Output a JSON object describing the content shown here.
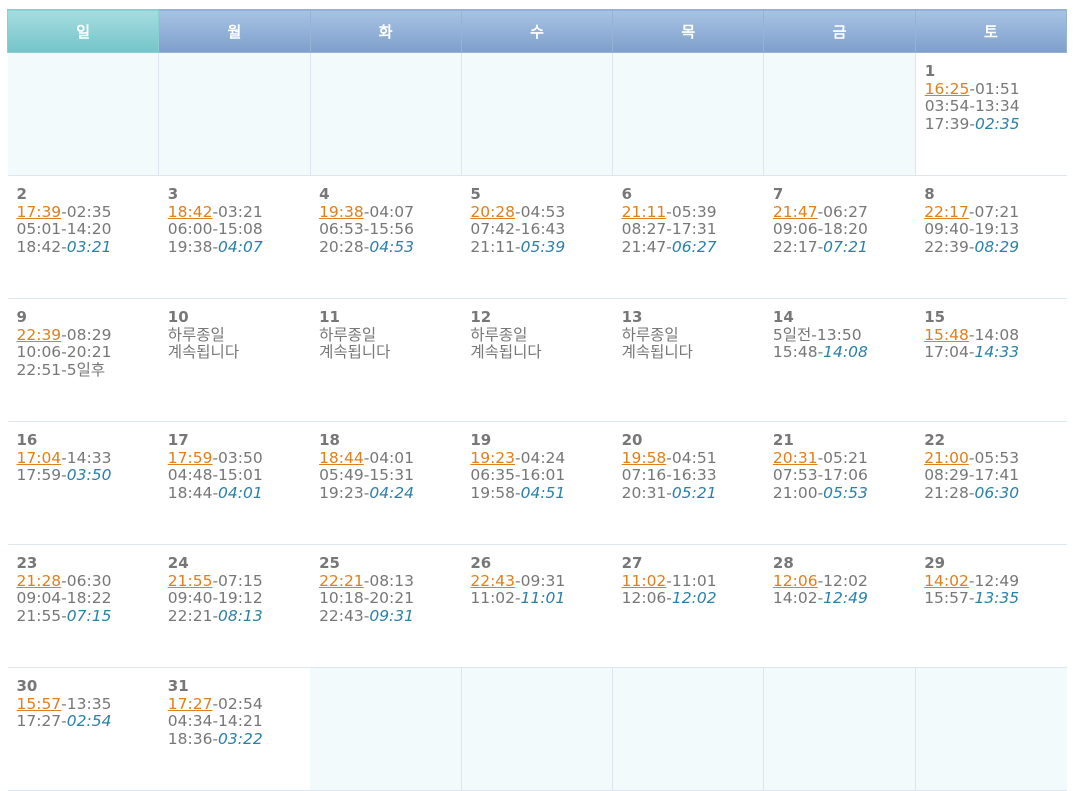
{
  "weekdays": [
    "일",
    "월",
    "화",
    "수",
    "목",
    "금",
    "토"
  ],
  "weeks": [
    [
      null,
      null,
      null,
      null,
      null,
      null,
      {
        "day": "1",
        "lines": [
          [
            {
              "t": "16:25",
              "c": "orange"
            },
            {
              "t": "-01:51"
            }
          ],
          [
            {
              "t": "03:54-13:34"
            }
          ],
          [
            {
              "t": "17:39-"
            },
            {
              "t": "02:35",
              "c": "blue"
            }
          ]
        ]
      }
    ],
    [
      {
        "day": "2",
        "lines": [
          [
            {
              "t": "17:39",
              "c": "orange"
            },
            {
              "t": "-02:35"
            }
          ],
          [
            {
              "t": "05:01-14:20"
            }
          ],
          [
            {
              "t": "18:42-"
            },
            {
              "t": "03:21",
              "c": "blue"
            }
          ]
        ]
      },
      {
        "day": "3",
        "lines": [
          [
            {
              "t": "18:42",
              "c": "orange"
            },
            {
              "t": "-03:21"
            }
          ],
          [
            {
              "t": "06:00-15:08"
            }
          ],
          [
            {
              "t": "19:38-"
            },
            {
              "t": "04:07",
              "c": "blue"
            }
          ]
        ]
      },
      {
        "day": "4",
        "lines": [
          [
            {
              "t": "19:38",
              "c": "orange"
            },
            {
              "t": "-04:07"
            }
          ],
          [
            {
              "t": "06:53-15:56"
            }
          ],
          [
            {
              "t": "20:28-"
            },
            {
              "t": "04:53",
              "c": "blue"
            }
          ]
        ]
      },
      {
        "day": "5",
        "lines": [
          [
            {
              "t": "20:28",
              "c": "orange"
            },
            {
              "t": "-04:53"
            }
          ],
          [
            {
              "t": "07:42-16:43"
            }
          ],
          [
            {
              "t": "21:11-"
            },
            {
              "t": "05:39",
              "c": "blue"
            }
          ]
        ]
      },
      {
        "day": "6",
        "lines": [
          [
            {
              "t": "21:11",
              "c": "orange"
            },
            {
              "t": "-05:39"
            }
          ],
          [
            {
              "t": "08:27-17:31"
            }
          ],
          [
            {
              "t": "21:47-"
            },
            {
              "t": "06:27",
              "c": "blue"
            }
          ]
        ]
      },
      {
        "day": "7",
        "lines": [
          [
            {
              "t": "21:47",
              "c": "orange"
            },
            {
              "t": "-06:27"
            }
          ],
          [
            {
              "t": "09:06-18:20"
            }
          ],
          [
            {
              "t": "22:17-"
            },
            {
              "t": "07:21",
              "c": "blue"
            }
          ]
        ]
      },
      {
        "day": "8",
        "lines": [
          [
            {
              "t": "22:17",
              "c": "orange"
            },
            {
              "t": "-07:21"
            }
          ],
          [
            {
              "t": "09:40-19:13"
            }
          ],
          [
            {
              "t": "22:39-"
            },
            {
              "t": "08:29",
              "c": "blue"
            }
          ]
        ]
      }
    ],
    [
      {
        "day": "9",
        "lines": [
          [
            {
              "t": "22:39",
              "c": "orange"
            },
            {
              "t": "-08:29"
            }
          ],
          [
            {
              "t": "10:06-20:21"
            }
          ],
          [
            {
              "t": "22:51-5일후"
            }
          ]
        ]
      },
      {
        "day": "10",
        "wrap": "하루종일 계속됩니다"
      },
      {
        "day": "11",
        "wrap": "하루종일 계속됩니다"
      },
      {
        "day": "12",
        "wrap": "하루종일 계속됩니다"
      },
      {
        "day": "13",
        "wrap": "하루종일 계속됩니다"
      },
      {
        "day": "14",
        "lines": [
          [
            {
              "t": "5일전-13:50"
            }
          ],
          [
            {
              "t": "15:48-"
            },
            {
              "t": "14:08",
              "c": "blue"
            }
          ]
        ]
      },
      {
        "day": "15",
        "lines": [
          [
            {
              "t": "15:48",
              "c": "orange"
            },
            {
              "t": "-14:08"
            }
          ],
          [
            {
              "t": "17:04-"
            },
            {
              "t": "14:33",
              "c": "blue"
            }
          ]
        ]
      }
    ],
    [
      {
        "day": "16",
        "lines": [
          [
            {
              "t": "17:04",
              "c": "orange"
            },
            {
              "t": "-14:33"
            }
          ],
          [
            {
              "t": "17:59-"
            },
            {
              "t": "03:50",
              "c": "blue"
            }
          ]
        ]
      },
      {
        "day": "17",
        "lines": [
          [
            {
              "t": "17:59",
              "c": "orange"
            },
            {
              "t": "-03:50"
            }
          ],
          [
            {
              "t": "04:48-15:01"
            }
          ],
          [
            {
              "t": "18:44-"
            },
            {
              "t": "04:01",
              "c": "blue"
            }
          ]
        ]
      },
      {
        "day": "18",
        "lines": [
          [
            {
              "t": "18:44",
              "c": "orange"
            },
            {
              "t": "-04:01"
            }
          ],
          [
            {
              "t": "05:49-15:31"
            }
          ],
          [
            {
              "t": "19:23-"
            },
            {
              "t": "04:24",
              "c": "blue"
            }
          ]
        ]
      },
      {
        "day": "19",
        "lines": [
          [
            {
              "t": "19:23",
              "c": "orange"
            },
            {
              "t": "-04:24"
            }
          ],
          [
            {
              "t": "06:35-16:01"
            }
          ],
          [
            {
              "t": "19:58-"
            },
            {
              "t": "04:51",
              "c": "blue"
            }
          ]
        ]
      },
      {
        "day": "20",
        "lines": [
          [
            {
              "t": "19:58",
              "c": "orange"
            },
            {
              "t": "-04:51"
            }
          ],
          [
            {
              "t": "07:16-16:33"
            }
          ],
          [
            {
              "t": "20:31-"
            },
            {
              "t": "05:21",
              "c": "blue"
            }
          ]
        ]
      },
      {
        "day": "21",
        "lines": [
          [
            {
              "t": "20:31",
              "c": "orange"
            },
            {
              "t": "-05:21"
            }
          ],
          [
            {
              "t": "07:53-17:06"
            }
          ],
          [
            {
              "t": "21:00-"
            },
            {
              "t": "05:53",
              "c": "blue"
            }
          ]
        ]
      },
      {
        "day": "22",
        "lines": [
          [
            {
              "t": "21:00",
              "c": "orange"
            },
            {
              "t": "-05:53"
            }
          ],
          [
            {
              "t": "08:29-17:41"
            }
          ],
          [
            {
              "t": "21:28-"
            },
            {
              "t": "06:30",
              "c": "blue"
            }
          ]
        ]
      }
    ],
    [
      {
        "day": "23",
        "lines": [
          [
            {
              "t": "21:28",
              "c": "orange"
            },
            {
              "t": "-06:30"
            }
          ],
          [
            {
              "t": "09:04-18:22"
            }
          ],
          [
            {
              "t": "21:55-"
            },
            {
              "t": "07:15",
              "c": "blue"
            }
          ]
        ]
      },
      {
        "day": "24",
        "lines": [
          [
            {
              "t": "21:55",
              "c": "orange"
            },
            {
              "t": "-07:15"
            }
          ],
          [
            {
              "t": "09:40-19:12"
            }
          ],
          [
            {
              "t": "22:21-"
            },
            {
              "t": "08:13",
              "c": "blue"
            }
          ]
        ]
      },
      {
        "day": "25",
        "lines": [
          [
            {
              "t": "22:21",
              "c": "orange"
            },
            {
              "t": "-08:13"
            }
          ],
          [
            {
              "t": "10:18-20:21"
            }
          ],
          [
            {
              "t": "22:43-"
            },
            {
              "t": "09:31",
              "c": "blue"
            }
          ]
        ]
      },
      {
        "day": "26",
        "lines": [
          [
            {
              "t": "22:43",
              "c": "orange"
            },
            {
              "t": "-09:31"
            }
          ],
          [
            {
              "t": "11:02-"
            },
            {
              "t": "11:01",
              "c": "blue"
            }
          ]
        ]
      },
      {
        "day": "27",
        "lines": [
          [
            {
              "t": "11:02",
              "c": "orange"
            },
            {
              "t": "-11:01"
            }
          ],
          [
            {
              "t": "12:06-"
            },
            {
              "t": "12:02",
              "c": "blue"
            }
          ]
        ]
      },
      {
        "day": "28",
        "lines": [
          [
            {
              "t": "12:06",
              "c": "orange"
            },
            {
              "t": "-12:02"
            }
          ],
          [
            {
              "t": "14:02-"
            },
            {
              "t": "12:49",
              "c": "blue"
            }
          ]
        ]
      },
      {
        "day": "29",
        "lines": [
          [
            {
              "t": "14:02",
              "c": "orange"
            },
            {
              "t": "-12:49"
            }
          ],
          [
            {
              "t": "15:57-"
            },
            {
              "t": "13:35",
              "c": "blue"
            }
          ]
        ]
      }
    ],
    [
      {
        "day": "30",
        "lines": [
          [
            {
              "t": "15:57",
              "c": "orange"
            },
            {
              "t": "-13:35"
            }
          ],
          [
            {
              "t": "17:27-"
            },
            {
              "t": "02:54",
              "c": "blue"
            }
          ]
        ]
      },
      {
        "day": "31",
        "lines": [
          [
            {
              "t": "17:27",
              "c": "orange"
            },
            {
              "t": "-02:54"
            }
          ],
          [
            {
              "t": "04:34-14:21"
            }
          ],
          [
            {
              "t": "18:36-"
            },
            {
              "t": "03:22",
              "c": "blue"
            }
          ]
        ]
      },
      null,
      null,
      null,
      null,
      null
    ]
  ],
  "colors": {
    "highlight": "#e07f1b",
    "end": "#2a80a8",
    "text": "#777777",
    "header": "#8aa8d2",
    "sunday_header": "#7fc9cd",
    "empty_cell": "#f3fafb"
  }
}
